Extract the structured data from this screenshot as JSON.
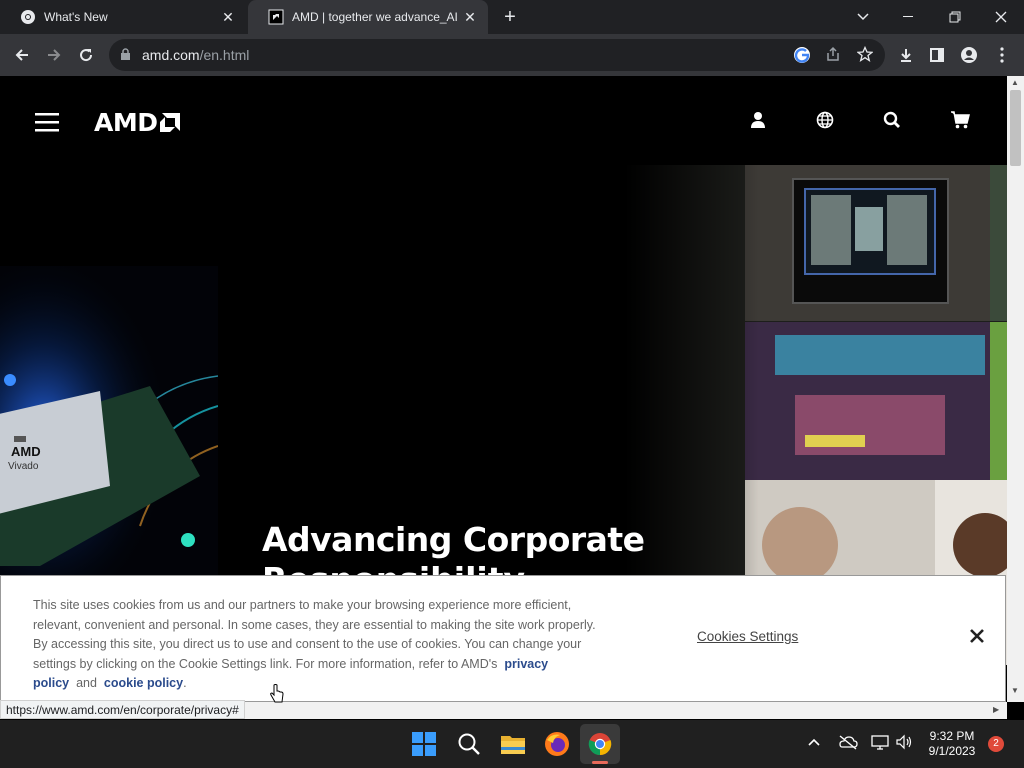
{
  "tabs": [
    {
      "label": "What's New",
      "active": false
    },
    {
      "label": "AMD | together we advance_AI",
      "active": true
    }
  ],
  "address": {
    "domain": "amd.com",
    "path": "/en.html"
  },
  "site": {
    "logo": "AMD",
    "hero_title_line1": "Advancing Corporate",
    "hero_title_line2": "Responsibility",
    "chip_label": "AMD",
    "chip_sublabel": "Vivado"
  },
  "cookie_banner": {
    "text_before": "This site uses cookies from us and our partners to make your browsing experience more efficient, relevant, convenient and personal. In some cases, they are essential to making the site work properly. By accessing this site, you direct us to use and consent to the use of cookies. You can change your settings by clicking on the Cookie Settings link. For more information, refer to AMD's",
    "privacy_link": "privacy policy",
    "and_text": "and",
    "cookie_link": "cookie policy",
    "period": ".",
    "settings_label": "Cookies Settings",
    "close_label": "×"
  },
  "status_bar_url": "https://www.amd.com/en/corporate/privacy#",
  "clock": {
    "time": "9:32 PM",
    "date": "9/1/2023"
  },
  "notification_count": "2",
  "colors": {
    "accent_link": "#2b4b8c",
    "chrome_dark": "#202124",
    "chrome_toolbar": "#35363a",
    "taskbar": "#202020"
  }
}
